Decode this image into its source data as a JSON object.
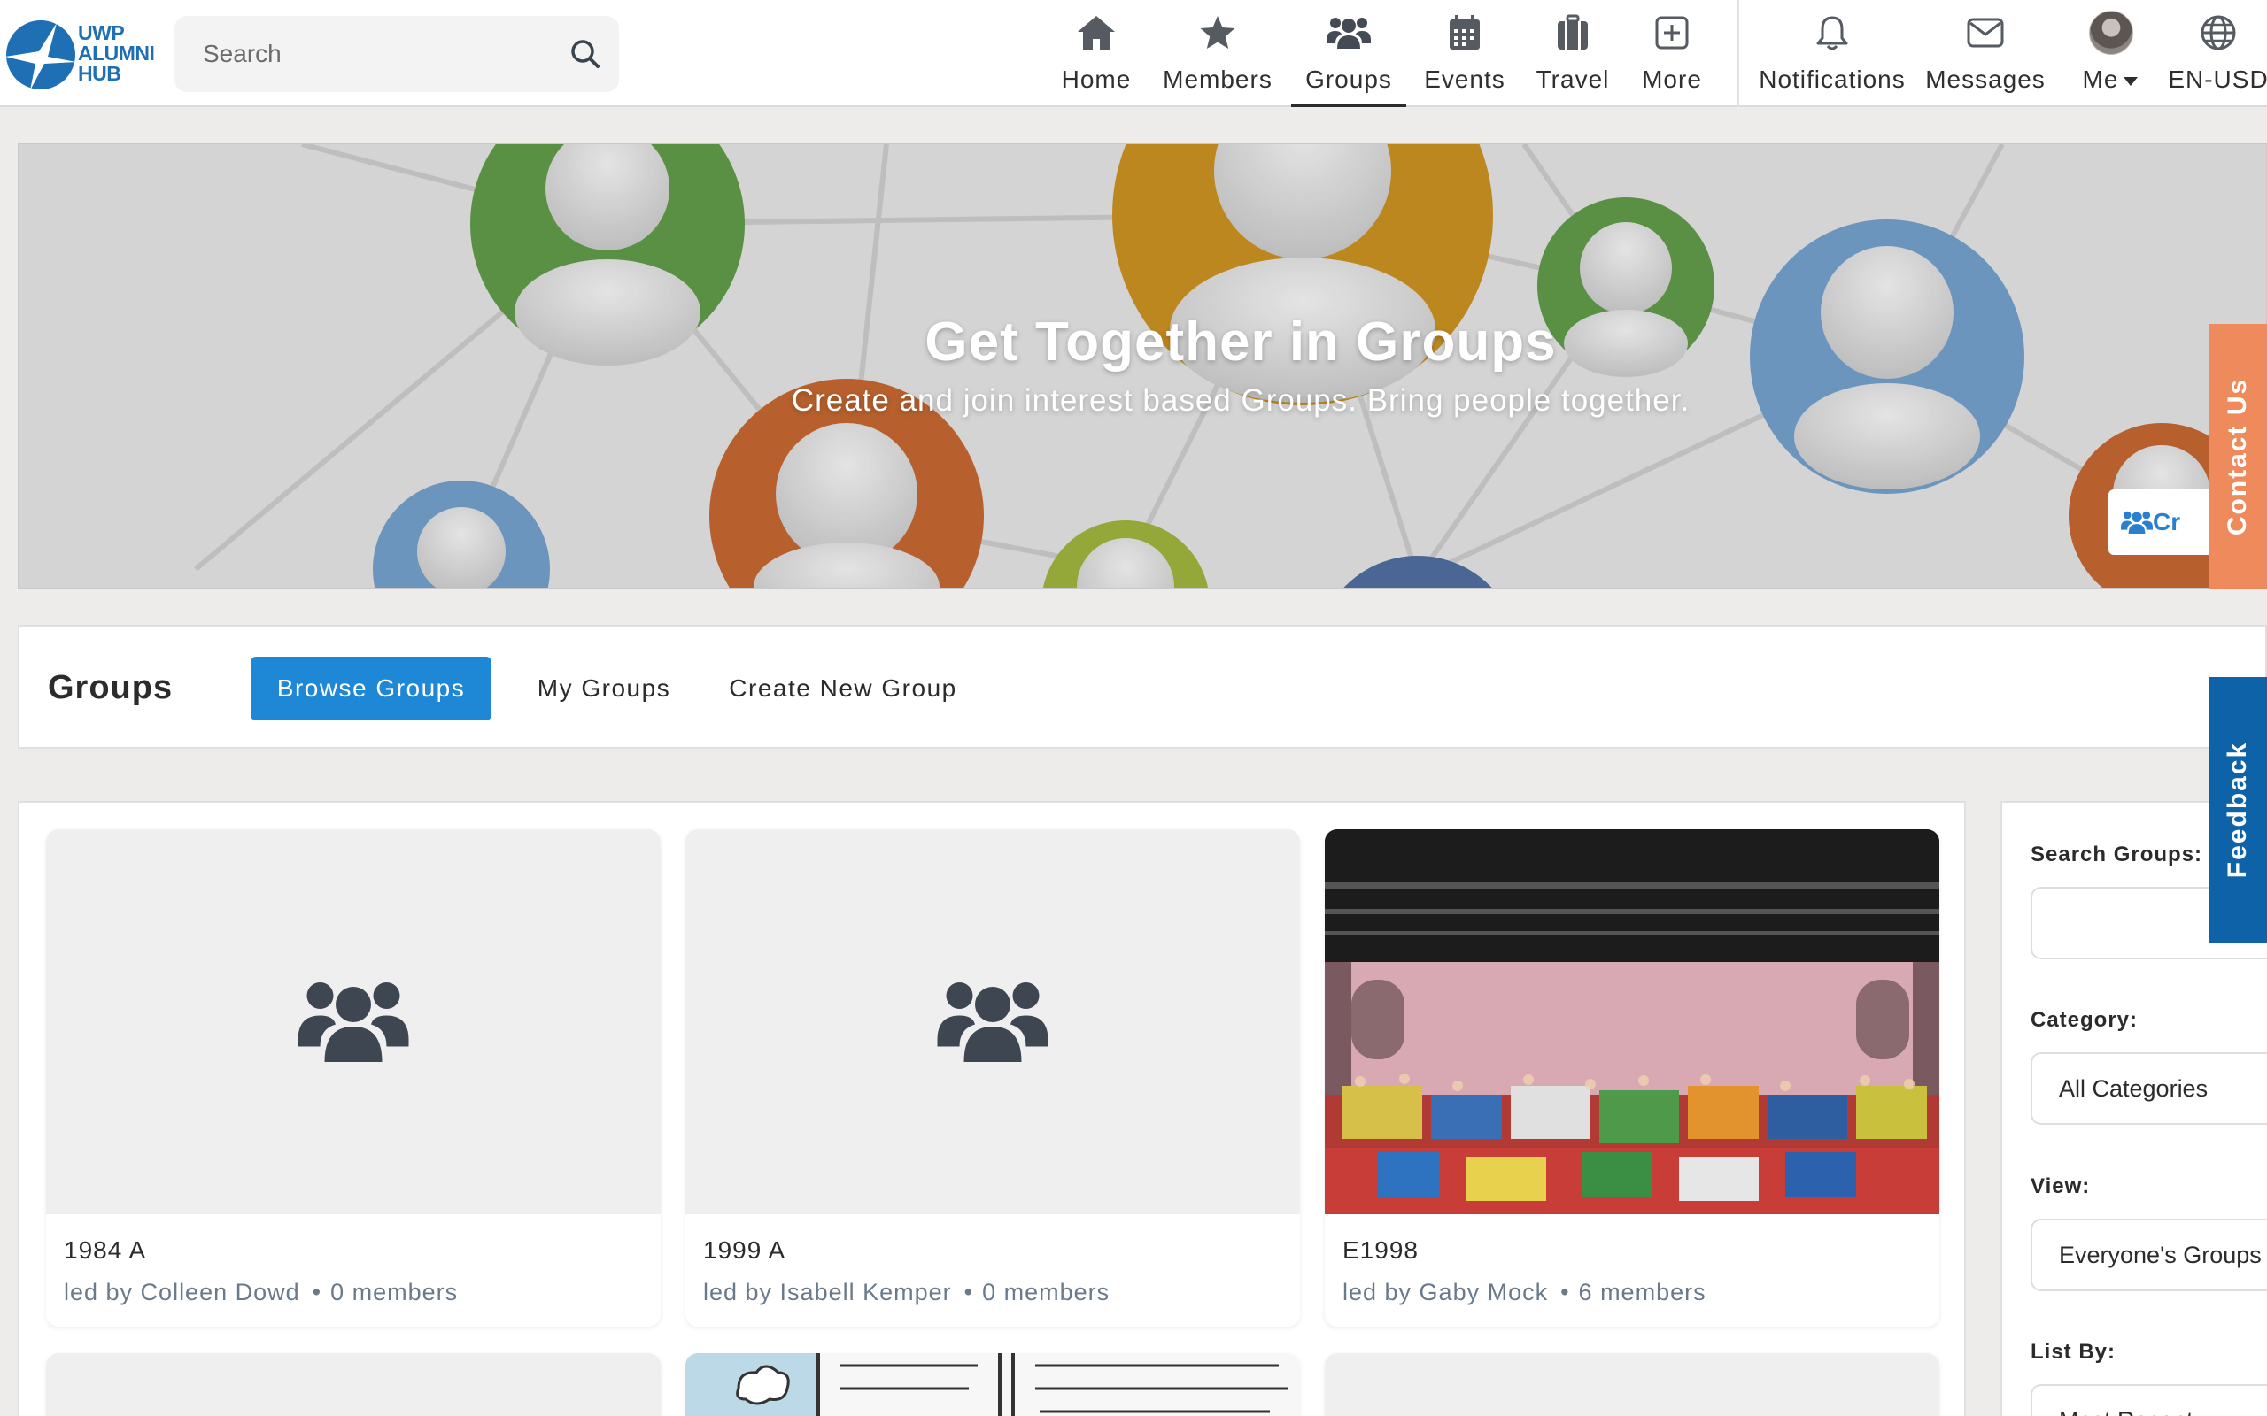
{
  "brand": {
    "logo_text_line1": "UWP",
    "logo_text_line2": "ALUMNI",
    "logo_text_line3": "HUB",
    "color": "#1f6fb5"
  },
  "search": {
    "placeholder": "Search"
  },
  "nav": {
    "items": [
      {
        "label": "Home",
        "icon": "home-icon"
      },
      {
        "label": "Members",
        "icon": "star-icon"
      },
      {
        "label": "Groups",
        "icon": "people-icon",
        "active": true
      },
      {
        "label": "Events",
        "icon": "calendar-icon"
      },
      {
        "label": "Travel",
        "icon": "suitcase-icon"
      },
      {
        "label": "More",
        "icon": "plus-square-icon"
      }
    ],
    "right": [
      {
        "label": "Notifications",
        "icon": "bell-icon"
      },
      {
        "label": "Messages",
        "icon": "envelope-icon"
      },
      {
        "label": "Me",
        "icon": "avatar"
      },
      {
        "label": "EN-USD",
        "icon": "globe-icon"
      }
    ]
  },
  "hero": {
    "title": "Get Together in Groups",
    "subtitle": "Create and join interest based Groups. Bring people together.",
    "create_button": "Cr"
  },
  "groups_bar": {
    "title": "Groups",
    "tabs": [
      {
        "label": "Browse Groups",
        "active": true
      },
      {
        "label": "My Groups"
      },
      {
        "label": "Create New Group"
      }
    ]
  },
  "groups": [
    {
      "name": "1984 A",
      "leader": "led by Colleen Dowd",
      "members": "0 members",
      "image": "placeholder"
    },
    {
      "name": "1999 A",
      "leader": "led by Isabell Kemper",
      "members": "0 members",
      "image": "placeholder"
    },
    {
      "name": "E1998",
      "leader": "led by Gaby Mock",
      "members": "6 members",
      "image": "photo"
    }
  ],
  "filters": {
    "search_label": "Search Groups:",
    "search_value": "",
    "category_label": "Category:",
    "category_value": "All Categories",
    "view_label": "View:",
    "view_value": "Everyone's Groups",
    "listby_label": "List By:",
    "listby_value": "Most Recent"
  },
  "side_tabs": {
    "contact": "Contact Us",
    "feedback": "Feedback"
  },
  "colors": {
    "primary": "#1e88d6",
    "contact": "#ef8a5c",
    "feedback": "#0e62a8"
  }
}
